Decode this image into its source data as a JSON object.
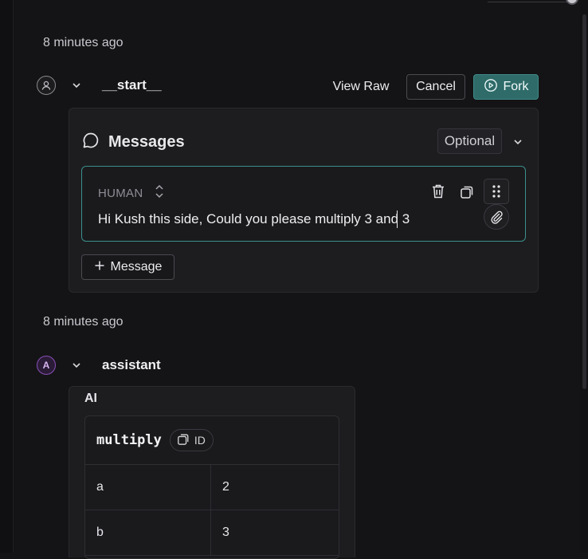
{
  "thread": {
    "entries": [
      {
        "timestamp": "8 minutes ago",
        "node_name": "__start__",
        "actions": {
          "view_raw": "View Raw",
          "cancel": "Cancel",
          "fork": "Fork"
        },
        "messages_section": {
          "title": "Messages",
          "optional_label": "Optional",
          "message": {
            "role": "HUMAN",
            "text": "Hi Kush this side, Could you please multiply 3 and 3"
          },
          "add_message_label": "Message"
        }
      },
      {
        "timestamp": "8 minutes ago",
        "avatar_letter": "A",
        "node_name": "assistant",
        "ai_label": "AI",
        "tool_call": {
          "name": "multiply",
          "id_label": "ID",
          "args": [
            {
              "key": "a",
              "value": "2"
            },
            {
              "key": "b",
              "value": "3"
            }
          ]
        }
      }
    ]
  },
  "colors": {
    "accent_teal": "#2e6b69",
    "message_border": "#3b8f8b",
    "assistant_avatar": "#8a4fb8"
  },
  "icons": [
    "user-icon",
    "chevron-down-icon",
    "fork-play-icon",
    "chat-bubble-icon",
    "sort-arrows-icon",
    "trash-icon",
    "copy-icon",
    "drag-handle-icon",
    "paperclip-icon",
    "plus-icon"
  ]
}
